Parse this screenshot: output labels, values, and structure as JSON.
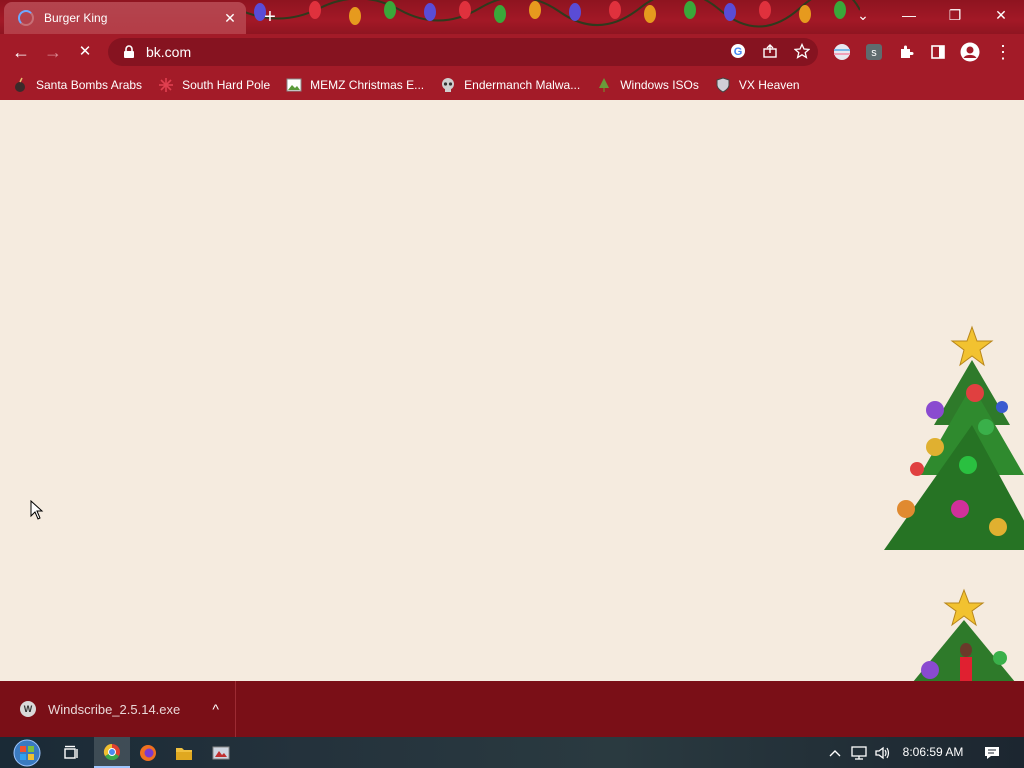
{
  "browser": {
    "tab": {
      "title": "Burger King",
      "close_label": "✕"
    },
    "new_tab_label": "+",
    "window_controls": {
      "tab_search": "⌄",
      "minimize": "—",
      "restore": "❐",
      "close": "✕"
    },
    "toolbar": {
      "back": "←",
      "forward": "→",
      "stop": "✕",
      "url": "bk.com",
      "menu": "⋮"
    },
    "bookmarks": [
      {
        "label": "Santa Bombs Arabs",
        "icon": "bomb-icon"
      },
      {
        "label": "South Hard Pole",
        "icon": "snowflake-icon"
      },
      {
        "label": "MEMZ Christmas E...",
        "icon": "image-icon"
      },
      {
        "label": "Endermanch Malwa...",
        "icon": "skull-icon"
      },
      {
        "label": "Windows ISOs",
        "icon": "tree-icon"
      },
      {
        "label": "VX Heaven",
        "icon": "shield-icon"
      }
    ]
  },
  "downloads": {
    "items": [
      {
        "name": "Windscribe_2.5.14.exe",
        "icon_letter": "W"
      }
    ],
    "chevron": "^"
  },
  "taskbar": {
    "clock": "8:06:59 AM",
    "apps": [
      "start-orb",
      "task-view",
      "chrome",
      "firefox",
      "file-explorer",
      "memz"
    ],
    "tray": [
      "chevron-up-icon",
      "network-icon",
      "volume-icon",
      "notification-icon"
    ]
  },
  "colors": {
    "theme_red": "#a31b28",
    "page_bg": "#f5ebdf",
    "downloads_bg": "#7a0f17"
  }
}
